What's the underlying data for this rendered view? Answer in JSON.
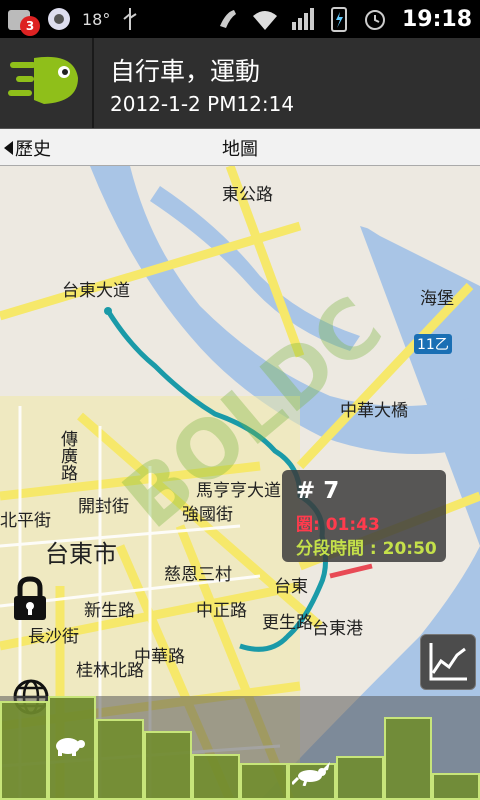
{
  "status_bar": {
    "notification_count": "3",
    "temperature": "18°",
    "time": "19:18"
  },
  "header": {
    "title": "自行車，運動",
    "datetime": "2012-1-2 PM12:14"
  },
  "tabs": {
    "back_label": "歷史",
    "map_label": "地圖"
  },
  "map": {
    "labels": [
      "台東市",
      "海堡",
      "開封街",
      "傳廣路",
      "馬亨亨大道",
      "強國街",
      "慈恩三村",
      "台東",
      "台東港",
      "中華大橋",
      "中正路",
      "更生路",
      "新生路",
      "長沙街",
      "桂林北路",
      "台東大道",
      "東公路",
      "中華路",
      "北平街",
      "11乙"
    ]
  },
  "popup": {
    "number": "# 7",
    "lap": "圈: 01:43",
    "split": "分段時間 : 20:50"
  },
  "speed_bars": {
    "values": [
      0.95,
      1.0,
      0.78,
      0.66,
      0.44,
      0.36,
      0.36,
      0.42,
      0.8,
      0.26
    ]
  },
  "colors": {
    "route": "#1a9aa8",
    "lap_segment": "#e84a55",
    "bar_fill": "#6e8c28",
    "bar_border": "#c7e57a"
  }
}
